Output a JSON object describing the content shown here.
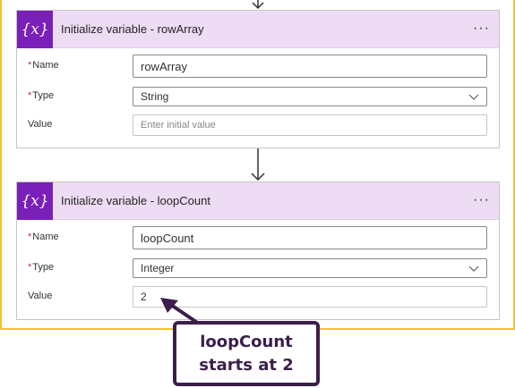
{
  "cards": [
    {
      "icon_text": "{x}",
      "title": "Initialize variable - rowArray",
      "more_label": "···",
      "name_label": "Name",
      "name_value": "rowArray",
      "type_label": "Type",
      "type_value": "String",
      "value_label": "Value",
      "value_placeholder": "Enter initial value",
      "value_value": ""
    },
    {
      "icon_text": "{x}",
      "title": "Initialize variable - loopCount",
      "more_label": "···",
      "name_label": "Name",
      "name_value": "loopCount",
      "type_label": "Type",
      "type_value": "Integer",
      "value_label": "Value",
      "value_placeholder": "",
      "value_value": "2"
    }
  ],
  "required_marker": "*",
  "callout": {
    "line1": "loopCount",
    "line2": "starts at 2"
  },
  "colors": {
    "card_header_bg": "#eddcf4",
    "variable_icon_bg": "#7a1fb8",
    "canvas_border": "#f2c22e",
    "callout": "#3b1e4a",
    "required": "#c4314b"
  },
  "icons": {
    "flow_arrow": "arrow-down-icon",
    "variable": "variable-icon",
    "more": "more-icon",
    "dropdown": "chevron-down-icon"
  }
}
